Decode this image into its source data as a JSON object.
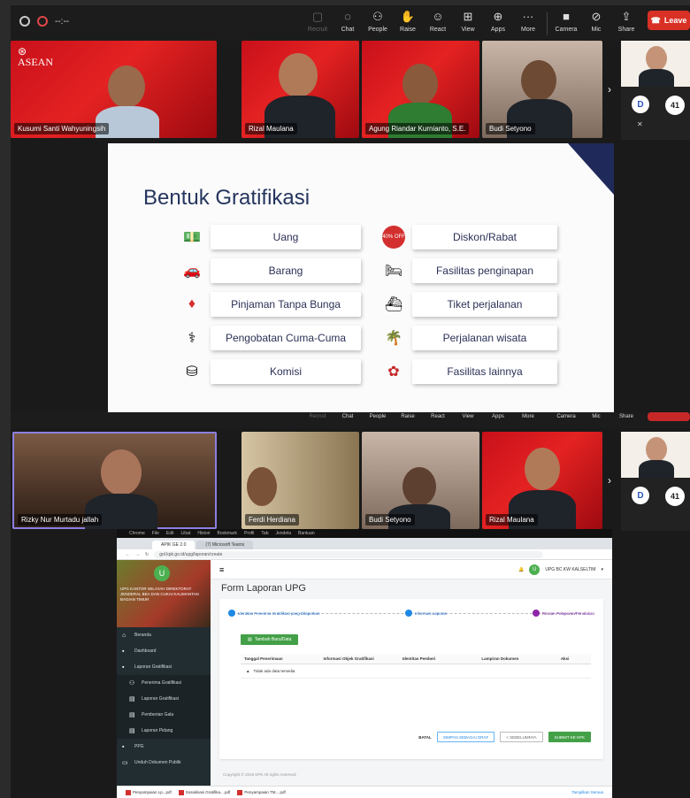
{
  "toolbar": {
    "time": "--:--",
    "items": [
      {
        "label": "Recruit",
        "icon": "recruit-icon"
      },
      {
        "label": "Chat",
        "icon": "chat-icon"
      },
      {
        "label": "People",
        "icon": "people-icon"
      },
      {
        "label": "Raise",
        "icon": "raise-hand-icon"
      },
      {
        "label": "React",
        "icon": "react-icon"
      },
      {
        "label": "View",
        "icon": "view-icon"
      },
      {
        "label": "Apps",
        "icon": "apps-icon"
      },
      {
        "label": "More",
        "icon": "more-icon"
      }
    ],
    "device_items": [
      {
        "label": "Camera",
        "icon": "camera-icon"
      },
      {
        "label": "Mic",
        "icon": "mic-off-icon"
      },
      {
        "label": "Share",
        "icon": "share-icon"
      }
    ],
    "leave_label": "Leave"
  },
  "participants_top": [
    "Kusumi Santi Wahyuningsih",
    "Rizal Maulana",
    "Agung Riandar Kurnianto, S.E.",
    "Budi Setyono"
  ],
  "participants_bottom": [
    "Rizky Nur Murtadu jallah",
    "Ferdi Herdiana",
    "Budi Setyono",
    "Rizal Maulana"
  ],
  "side_avatar_letter": "D",
  "side_more_count": "41",
  "slide": {
    "title": "Bentuk Gratifikasi",
    "left_items": [
      "Uang",
      "Barang",
      "Pinjaman Tanpa Bunga",
      "Pengobatan Cuma-Cuma",
      "Komisi"
    ],
    "right_items": [
      "Diskon/Rabat",
      "Fasilitas penginapan",
      "Tiket perjalanan",
      "Perjalanan wisata",
      "Fasilitas lainnya"
    ],
    "discount_badge": "40% OFF"
  },
  "browser": {
    "os_menu": [
      "Chrome",
      "File",
      "Edit",
      "Lihat",
      "Histori",
      "Bookmark",
      "Profil",
      "Tab",
      "Jendela",
      "Bantuan"
    ],
    "tabs": [
      "APIK GE 2.0",
      "(7) Microsoft Teams"
    ],
    "url": "gol.kpk.go.id/upg/laporan/create",
    "user_initial": "U",
    "user_name": "UPG BC KW KALSELTIM",
    "sidebar_org": "UPG KANTOR WILAYAH DIREKTORAT JENDERAL BEA DAN CUKAI KALIMANTAN BAGIAN TIMUR",
    "sidebar_items": [
      {
        "label": "Beranda",
        "sub": false
      },
      {
        "label": "Dashboard",
        "sub": false
      },
      {
        "label": "Laporan Gratifikasi",
        "sub": false
      },
      {
        "label": "Penerima Gratifikasi",
        "sub": true
      },
      {
        "label": "Laporan Gratifikasi",
        "sub": true
      },
      {
        "label": "Pemberian Gala",
        "sub": true
      },
      {
        "label": "Laporan Pidang",
        "sub": true
      },
      {
        "label": "PPG",
        "sub": false
      },
      {
        "label": "Unduh Dokumen Publik",
        "sub": false
      }
    ],
    "form_title": "Form Laporan UPG",
    "steps": [
      "Identitas Penerima Gratifikasi yang Dilaporkan",
      "Informasi Laporan",
      "Rincian Pelaporan/Penolakan"
    ],
    "add_button": "Tambah Baru/Data",
    "table_headers": [
      "Tanggal Penerimaan",
      "Informasi Objek Gratifikasi",
      "Identitas Pemberi",
      "Lampiran Dokumen",
      "Aksi"
    ],
    "empty_text": "Tidak ada data tersedia",
    "actions": {
      "batal": "BATAL",
      "draft": "SIMPAN SEBAGAI DRAF",
      "prev": "< SEBELUMNYA",
      "submit": "SUBMIT KE KPK"
    },
    "copyright": "Copyright © 2018 KPK All rights reserved.",
    "downloads": [
      "Penyampaian Lp...pdf",
      "Sosialisasi Gratifika....pdf",
      "Penyampaian TM....pdf"
    ],
    "download_show_all": "Tampilkan Semua"
  }
}
